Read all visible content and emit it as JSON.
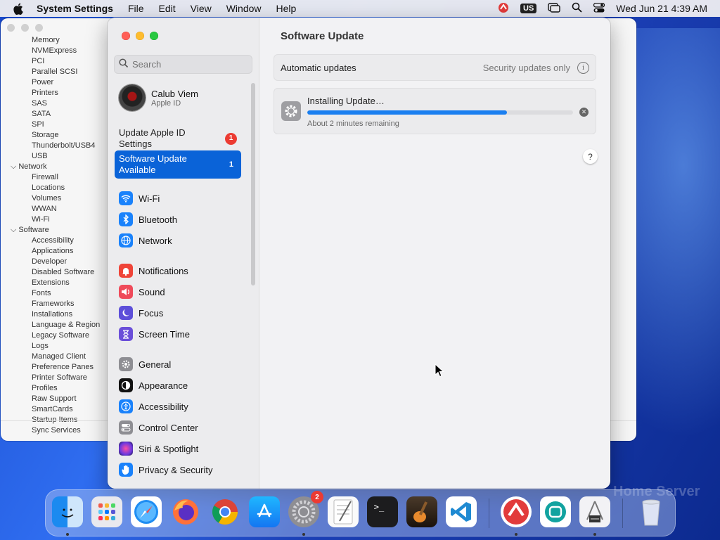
{
  "menubar": {
    "app_name": "System Settings",
    "menus": [
      "File",
      "Edit",
      "View",
      "Window",
      "Help"
    ],
    "input_source": "US",
    "datetime": "Wed Jun 21  4:39 AM"
  },
  "background_window": {
    "hardware_items": [
      "Memory",
      "NVMExpress",
      "PCI",
      "Parallel SCSI",
      "Power",
      "Printers",
      "SAS",
      "SATA",
      "SPI",
      "Storage",
      "Thunderbolt/USB4",
      "USB"
    ],
    "network_label": "Network",
    "network_items": [
      "Firewall",
      "Locations",
      "Volumes",
      "WWAN",
      "Wi-Fi"
    ],
    "software_label": "Software",
    "software_items": [
      "Accessibility",
      "Applications",
      "Developer",
      "Disabled Software",
      "Extensions",
      "Fonts",
      "Frameworks",
      "Installations",
      "Language & Region",
      "Legacy Software",
      "Logs",
      "Managed Client",
      "Preference Panes",
      "Printer Software",
      "Profiles",
      "Raw Support",
      "SmartCards",
      "Startup Items",
      "Sync Services"
    ]
  },
  "sidebar": {
    "search_placeholder": "Search",
    "user_name": "Calub Viem",
    "user_sub": "Apple ID",
    "notice1": {
      "label": "Update Apple ID Settings",
      "count": "1"
    },
    "notice2": {
      "label": "Software Update Available",
      "count": "1"
    },
    "group1": [
      {
        "label": "Wi-Fi",
        "icon": "wifi-icon",
        "color": "#1a82fb"
      },
      {
        "label": "Bluetooth",
        "icon": "bluetooth-icon",
        "color": "#1a82fb"
      },
      {
        "label": "Network",
        "icon": "globe-icon",
        "color": "#1a82fb"
      }
    ],
    "group2": [
      {
        "label": "Notifications",
        "icon": "bell-icon",
        "color": "#ef4438"
      },
      {
        "label": "Sound",
        "icon": "speaker-icon",
        "color": "#ef4a5a"
      },
      {
        "label": "Focus",
        "icon": "moon-icon",
        "color": "#5d4fd9"
      },
      {
        "label": "Screen Time",
        "icon": "hourglass-icon",
        "color": "#6b4fd9"
      }
    ],
    "group3": [
      {
        "label": "General",
        "icon": "gear-icon",
        "color": "#8e8e93"
      },
      {
        "label": "Appearance",
        "icon": "appearance-icon",
        "color": "#111111"
      },
      {
        "label": "Accessibility",
        "icon": "accessibility-icon",
        "color": "#1a82fb"
      },
      {
        "label": "Control Center",
        "icon": "toggles-icon",
        "color": "#8e8e93"
      },
      {
        "label": "Siri & Spotlight",
        "icon": "siri-icon",
        "color": "#b23cd6"
      },
      {
        "label": "Privacy & Security",
        "icon": "hand-icon",
        "color": "#1a82fb"
      }
    ]
  },
  "content": {
    "title": "Software Update",
    "auto_label": "Automatic updates",
    "auto_value": "Security updates only",
    "installing": "Installing Update…",
    "progress": 0.75,
    "remaining": "About 2 minutes remaining",
    "help": "?"
  },
  "dock": {
    "settings_badge": "2",
    "apps": [
      "finder-icon",
      "launchpad-icon",
      "safari-icon",
      "firefox-icon",
      "chrome-icon",
      "app-store-icon",
      "system-settings-icon",
      "textedit-icon",
      "terminal-icon",
      "garageband-icon",
      "vscode-icon",
      "anydesk-icon",
      "pockity-icon",
      "system-info-icon",
      "trash-icon"
    ]
  }
}
